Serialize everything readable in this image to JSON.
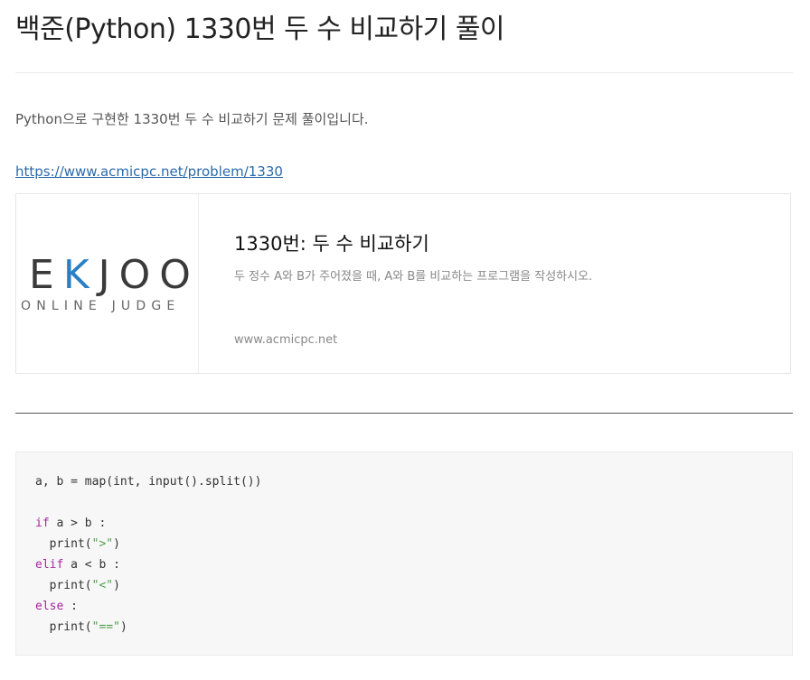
{
  "post": {
    "title": "백준(Python) 1330번 두 수 비교하기 풀이",
    "intro": "Python으로 구현한 1330번 두 수 비교하기 문제 풀이입니다.",
    "link": "https://www.acmicpc.net/problem/1330"
  },
  "link_card": {
    "logo_main_left": "E",
    "logo_main_k": "K",
    "logo_main_right": "JOO",
    "logo_sub": "ONLINE JUDGE",
    "title": "1330번: 두 수 비교하기",
    "description": "두 정수 A와 B가 주어졌을 때, A와 B를 비교하는 프로그램을 작성하시오.",
    "domain": "www.acmicpc.net"
  },
  "code": {
    "line1": "a, b = map(int, input().split())",
    "l3_kw": "if",
    "l3_rest": " a > b :",
    "l4_pre": "  print(",
    "l4_str": "\">\"",
    "l4_post": ")",
    "l5_kw": "elif",
    "l5_rest": " a < b :",
    "l6_pre": "  print(",
    "l6_str": "\"<\"",
    "l6_post": ")",
    "l7_kw": "else",
    "l7_rest": " :",
    "l8_pre": "  print(",
    "l8_str": "\"==\"",
    "l8_post": ")"
  }
}
